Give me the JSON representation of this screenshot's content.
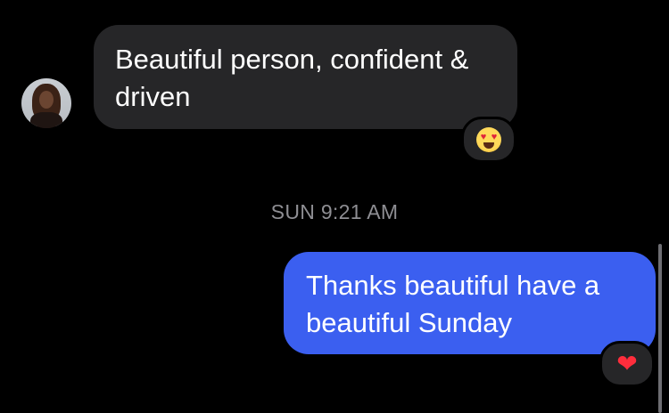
{
  "conversation": {
    "incoming_message": {
      "text": "Beautiful person,  confident & driven",
      "reaction_icon": "heart-eyes-emoji"
    },
    "timestamp": "SUN 9:21 AM",
    "outgoing_message": {
      "text": "Thanks beautiful have a beautiful Sunday",
      "reaction_icon": "red-heart-emoji",
      "reaction_glyph": "❤"
    }
  },
  "colors": {
    "background": "#000000",
    "incoming_bubble": "#262628",
    "outgoing_bubble": "#3b5ff0",
    "timestamp_text": "#8e8e93"
  }
}
